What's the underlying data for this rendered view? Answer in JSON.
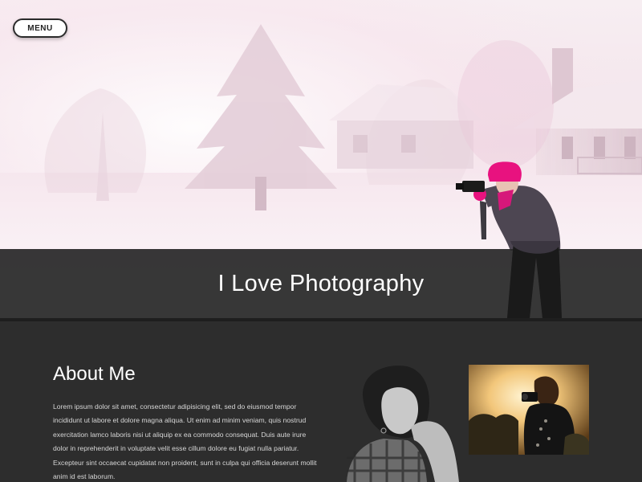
{
  "nav": {
    "menu_label": "MENU"
  },
  "hero": {
    "title": "I Love Photography"
  },
  "about": {
    "heading": "About Me",
    "body": "Lorem ipsum dolor sit amet, consectetur adipisicing elit, sed do eiusmod tempor incididunt ut labore et dolore magna aliqua. Ut enim ad minim veniam, quis nostrud exercitation lamco laboris nisi ut aliquip ex ea commodo consequat. Duis aute irure dolor in reprehenderit in voluptate velit esse cillum dolore eu fugiat nulla pariatur. Excepteur sint occaecat cupidatat non proident, sunt in culpa qui officia deserunt mollit anim id est laborum."
  },
  "colors": {
    "accent_hat": "#e8127f",
    "band_background": "#282828",
    "section_background": "#2d2d2d"
  }
}
